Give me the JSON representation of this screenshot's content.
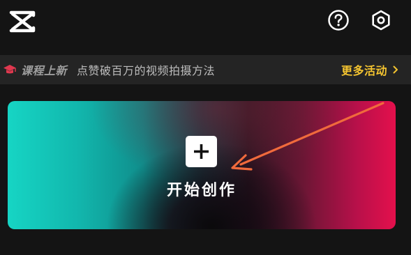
{
  "app": {
    "logo_icon": "capcut-logo-icon"
  },
  "header": {
    "help_icon": "help-circle-icon",
    "settings_icon": "hexagon-gear-icon"
  },
  "banner": {
    "icon": "graduation-cap-icon",
    "tag": "课程上新",
    "text": "点赞破百万的视频拍摄方法",
    "link_label": "更多活动",
    "link_icon": "chevron-right-icon",
    "link_color": "#f4c430"
  },
  "create_card": {
    "label": "开始创作",
    "icon": "plus-icon",
    "gradient_left": "#16d5c4",
    "gradient_right": "#e4104c"
  },
  "annotation": {
    "type": "arrow",
    "color": "#f06a3c"
  }
}
